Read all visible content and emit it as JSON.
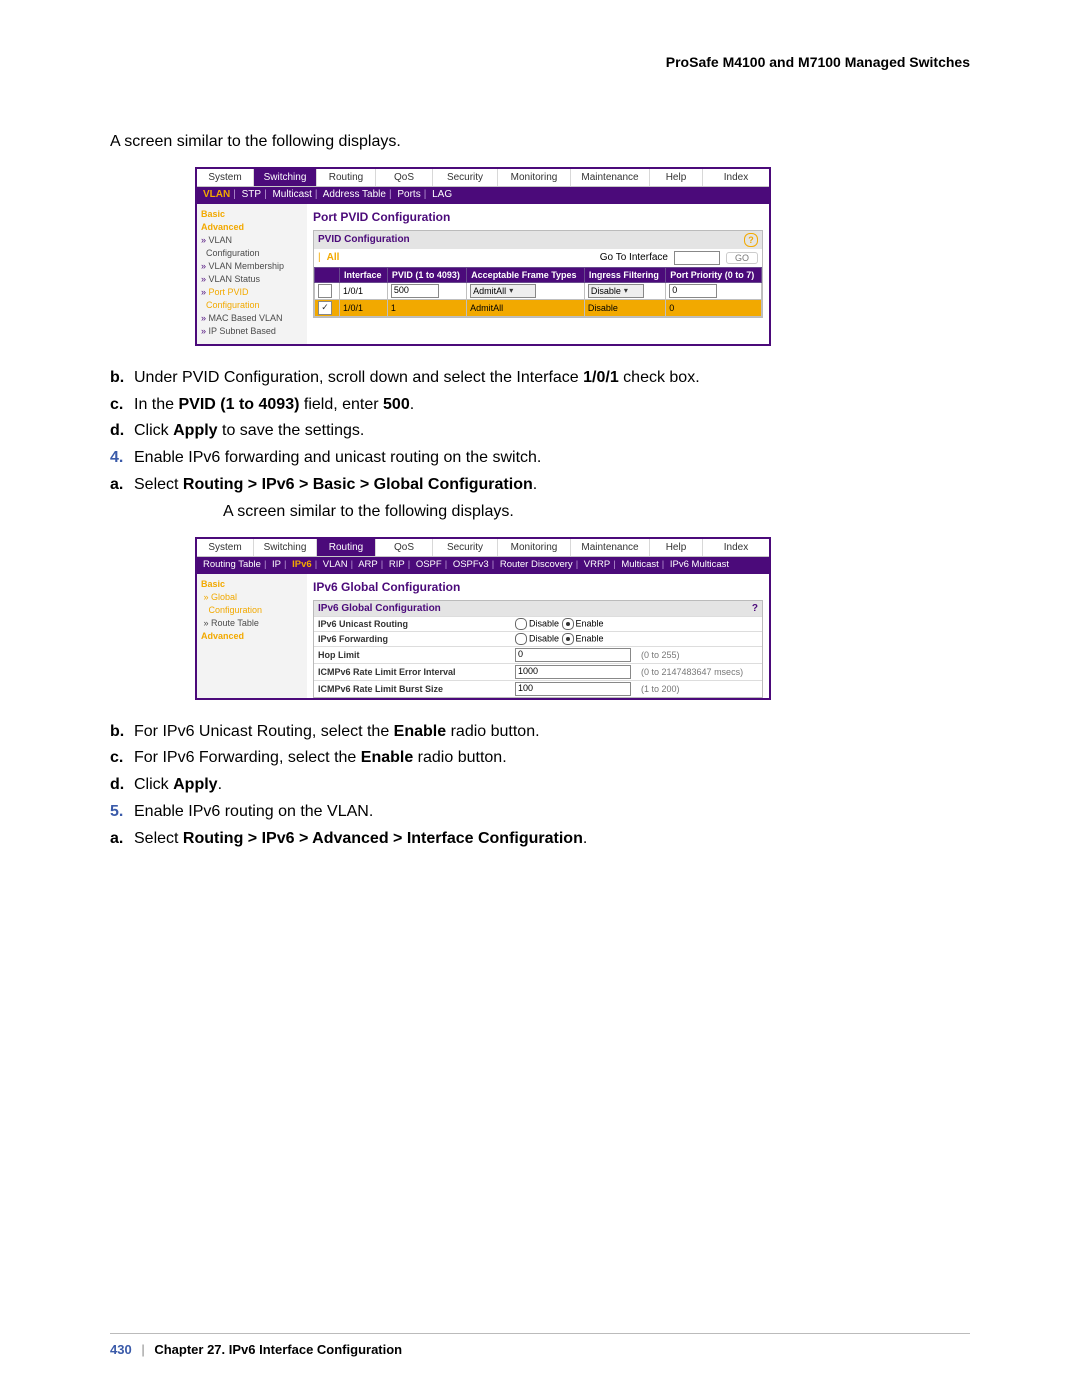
{
  "header": {
    "product": "ProSafe M4100 and M7100 Managed Switches"
  },
  "intro1": "A screen similar to the following displays.",
  "ss1": {
    "topnav": [
      "System",
      "Switching",
      "Routing",
      "QoS",
      "Security",
      "Monitoring",
      "Maintenance",
      "Help",
      "Index"
    ],
    "subnav": {
      "items": [
        "VLAN",
        "STP",
        "Multicast",
        "Address Table",
        "Ports",
        "LAG"
      ],
      "active": "VLAN"
    },
    "side": {
      "basic": "Basic",
      "advanced": "Advanced",
      "items": [
        "VLAN Configuration",
        "VLAN Membership",
        "VLAN Status",
        "Port PVID Configuration",
        "MAC Based VLAN",
        "IP Subnet Based"
      ],
      "selected": "Port PVID Configuration"
    },
    "main": {
      "title": "Port PVID Configuration",
      "box_title": "PVID Configuration",
      "all": "All",
      "goto": "Go To Interface",
      "go": "GO",
      "columns": [
        "",
        "Interface",
        "PVID (1 to 4093)",
        "Acceptable Frame Types",
        "Ingress Filtering",
        "Port Priority (0 to 7)"
      ],
      "row_input": {
        "check": false,
        "iface": "1/0/1",
        "pvid": "500",
        "aft": "AdmitAll",
        "ing": "Disable",
        "pri": "0"
      },
      "row_sel": {
        "check": true,
        "iface": "1/0/1",
        "pvid": "1",
        "aft": "AdmitAll",
        "ing": "Disable",
        "pri": "0"
      }
    }
  },
  "steps_mid": {
    "b": "Under PVID Configuration, scroll down and select the Interface ",
    "b_bold": "1/0/1",
    "b_tail": " check box.",
    "c_pre": "In the ",
    "c_bold1": "PVID (1 to 4093)",
    "c_mid": " field, enter ",
    "c_bold2": "500",
    "c_tail": ".",
    "d_pre": "Click ",
    "d_bold": "Apply",
    "d_tail": " to save the settings.",
    "s4": "Enable IPv6 forwarding and unicast routing on the switch.",
    "s4a_pre": "Select ",
    "s4a_bold": "Routing > IPv6 > Basic > Global Configuration",
    "s4a_tail": ".",
    "intro2": "A screen similar to the following displays."
  },
  "ss2": {
    "topnav": [
      "System",
      "Switching",
      "Routing",
      "QoS",
      "Security",
      "Monitoring",
      "Maintenance",
      "Help",
      "Index"
    ],
    "subnav": [
      "Routing Table",
      "IP",
      "IPv6",
      "VLAN",
      "ARP",
      "RIP",
      "OSPF",
      "OSPFv3",
      "Router Discovery",
      "VRRP",
      "Multicast",
      "IPv6 Multicast"
    ],
    "subnav_active": "IPv6",
    "side": {
      "basic": "Basic",
      "global": "Global Configuration",
      "route": "Route Table",
      "advanced": "Advanced"
    },
    "main": {
      "title": "IPv6 Global Configuration",
      "box": "IPv6 Global Configuration",
      "rows": [
        {
          "label": "IPv6 Unicast Routing",
          "type": "radio",
          "disable": "Disable",
          "enable": "Enable",
          "sel": "enable"
        },
        {
          "label": "IPv6 Forwarding",
          "type": "radio",
          "disable": "Disable",
          "enable": "Enable",
          "sel": "enable"
        },
        {
          "label": "Hop Limit",
          "type": "input",
          "value": "0",
          "hint": "(0 to 255)"
        },
        {
          "label": "ICMPv6 Rate Limit Error Interval",
          "type": "input",
          "value": "1000",
          "hint": "(0 to 2147483647 msecs)"
        },
        {
          "label": "ICMPv6 Rate Limit Burst Size",
          "type": "input",
          "value": "100",
          "hint": "(1 to 200)"
        }
      ]
    }
  },
  "steps_after": {
    "b_pre": "For IPv6 Unicast Routing, select the ",
    "b_bold": "Enable",
    "b_tail": " radio button.",
    "c_pre": "For IPv6 Forwarding, select the ",
    "c_bold": "Enable",
    "c_tail": " radio button.",
    "d_pre": "Click ",
    "d_bold": "Apply",
    "d_tail": ".",
    "s5": "Enable IPv6 routing on the VLAN.",
    "s5a_pre": "Select ",
    "s5a_bold": "Routing > IPv6 > Advanced > Interface Configuration",
    "s5a_tail": "."
  },
  "footer": {
    "page": "430",
    "chapter": "Chapter 27.  IPv6 Interface Configuration"
  }
}
